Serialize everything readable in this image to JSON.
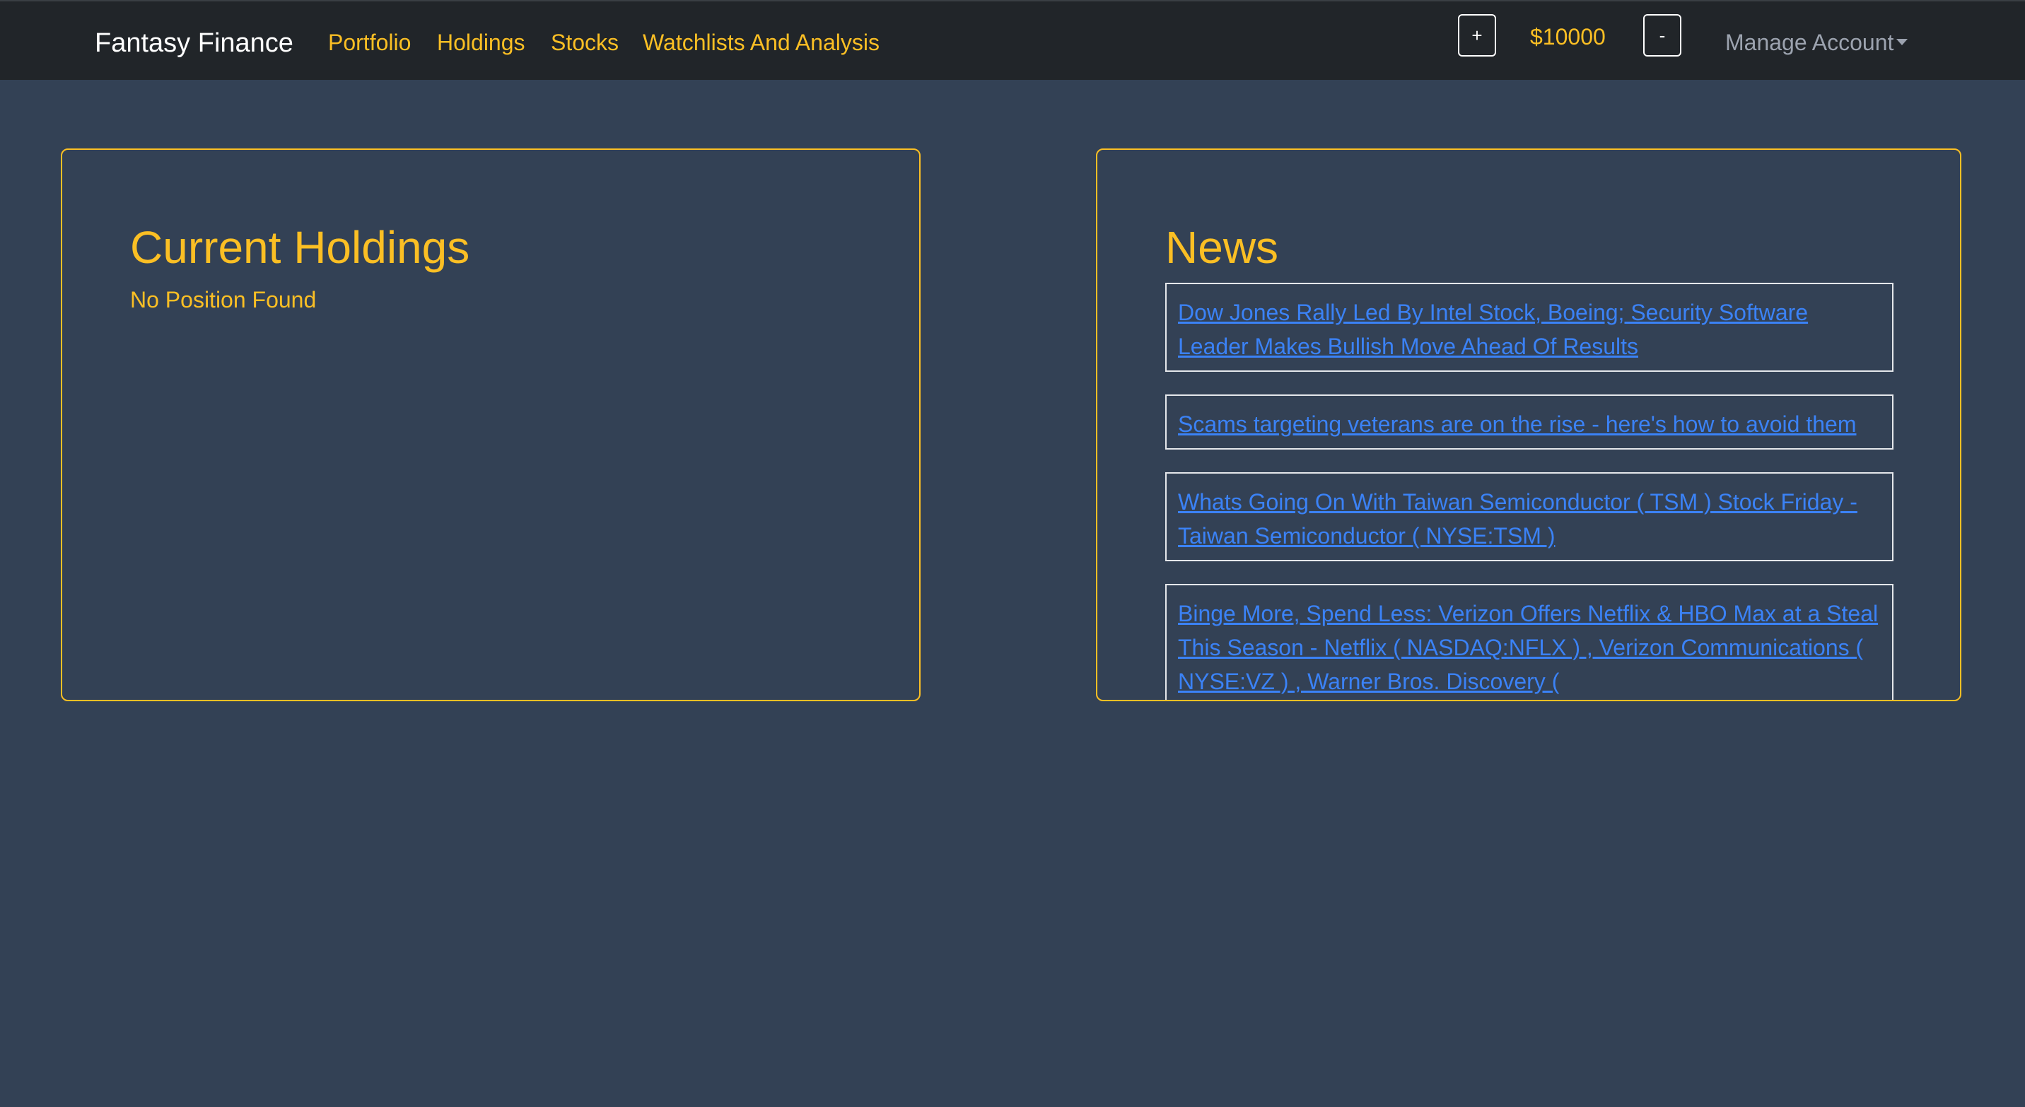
{
  "navbar": {
    "brand": "Fantasy Finance",
    "links": [
      "Portfolio",
      "Holdings",
      "Stocks",
      "Watchlists And Analysis"
    ],
    "add_button": "+",
    "balance": "$10000",
    "subtract_button": "-",
    "account_menu": "Manage Account"
  },
  "holdings": {
    "title": "Current Holdings",
    "empty_text": "No Position Found"
  },
  "news": {
    "title": "News",
    "items": [
      "Dow Jones Rally Led By Intel Stock, Boeing; Security Software Leader Makes Bullish Move Ahead Of Results",
      "Scams targeting veterans are on the rise - here's how to avoid them",
      "Whats Going On With Taiwan Semiconductor ( TSM ) Stock Friday - Taiwan Semiconductor ( NYSE:TSM )",
      "Binge More, Spend Less: Verizon Offers Netflix & HBO Max at a Steal This Season - Netflix ( NASDAQ:NFLX ) , Verizon Communications ( NYSE:VZ ) , Warner Bros. Discovery ("
    ]
  },
  "colors": {
    "background": "#334155",
    "navbar": "#212529",
    "accent": "#fbbf24",
    "link": "#3b82f6"
  }
}
